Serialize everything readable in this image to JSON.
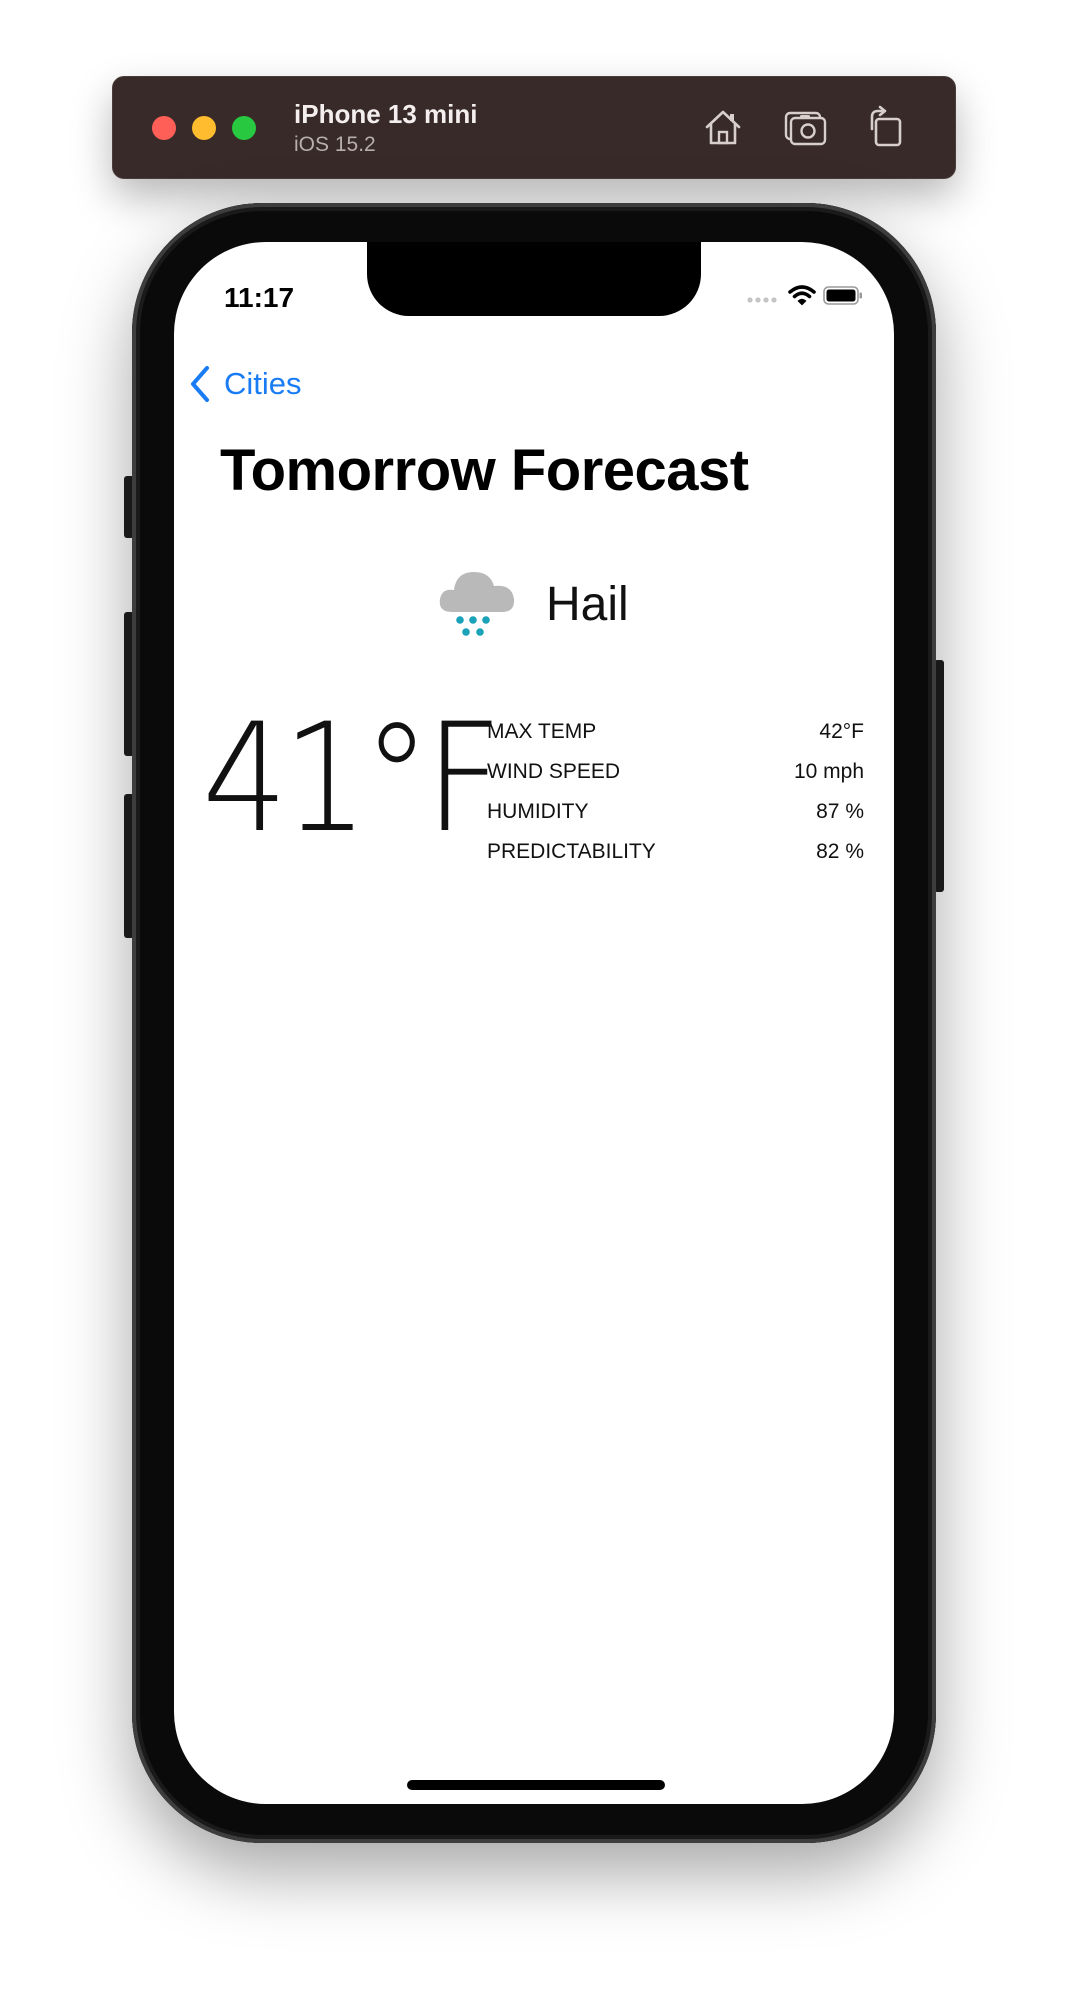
{
  "simulator": {
    "device_name": "iPhone 13 mini",
    "os_version": "iOS 15.2",
    "toolbar_icons": [
      "home-icon",
      "screenshot-icon",
      "rotate-icon"
    ]
  },
  "status_bar": {
    "time": "11:17",
    "icons": [
      "cellular-icon",
      "wifi-icon",
      "battery-icon"
    ]
  },
  "nav": {
    "back_label": "Cities",
    "back_icon": "chevron-left-icon"
  },
  "page": {
    "title": "Tomorrow Forecast"
  },
  "weather": {
    "condition": "Hail",
    "condition_icon": "hail-cloud-icon",
    "temperature": "41°F",
    "stats": [
      {
        "label": "MAX TEMP",
        "value": "42°F"
      },
      {
        "label": "WIND SPEED",
        "value": "10 mph"
      },
      {
        "label": "HUMIDITY",
        "value": "87 %"
      },
      {
        "label": "PREDICTABILITY",
        "value": "82 %"
      }
    ]
  },
  "colors": {
    "accent": "#1a7cf5",
    "hail_dots": "#1aa3b8",
    "cloud": "#b9b9b9",
    "toolbar_bg": "#372a28"
  }
}
